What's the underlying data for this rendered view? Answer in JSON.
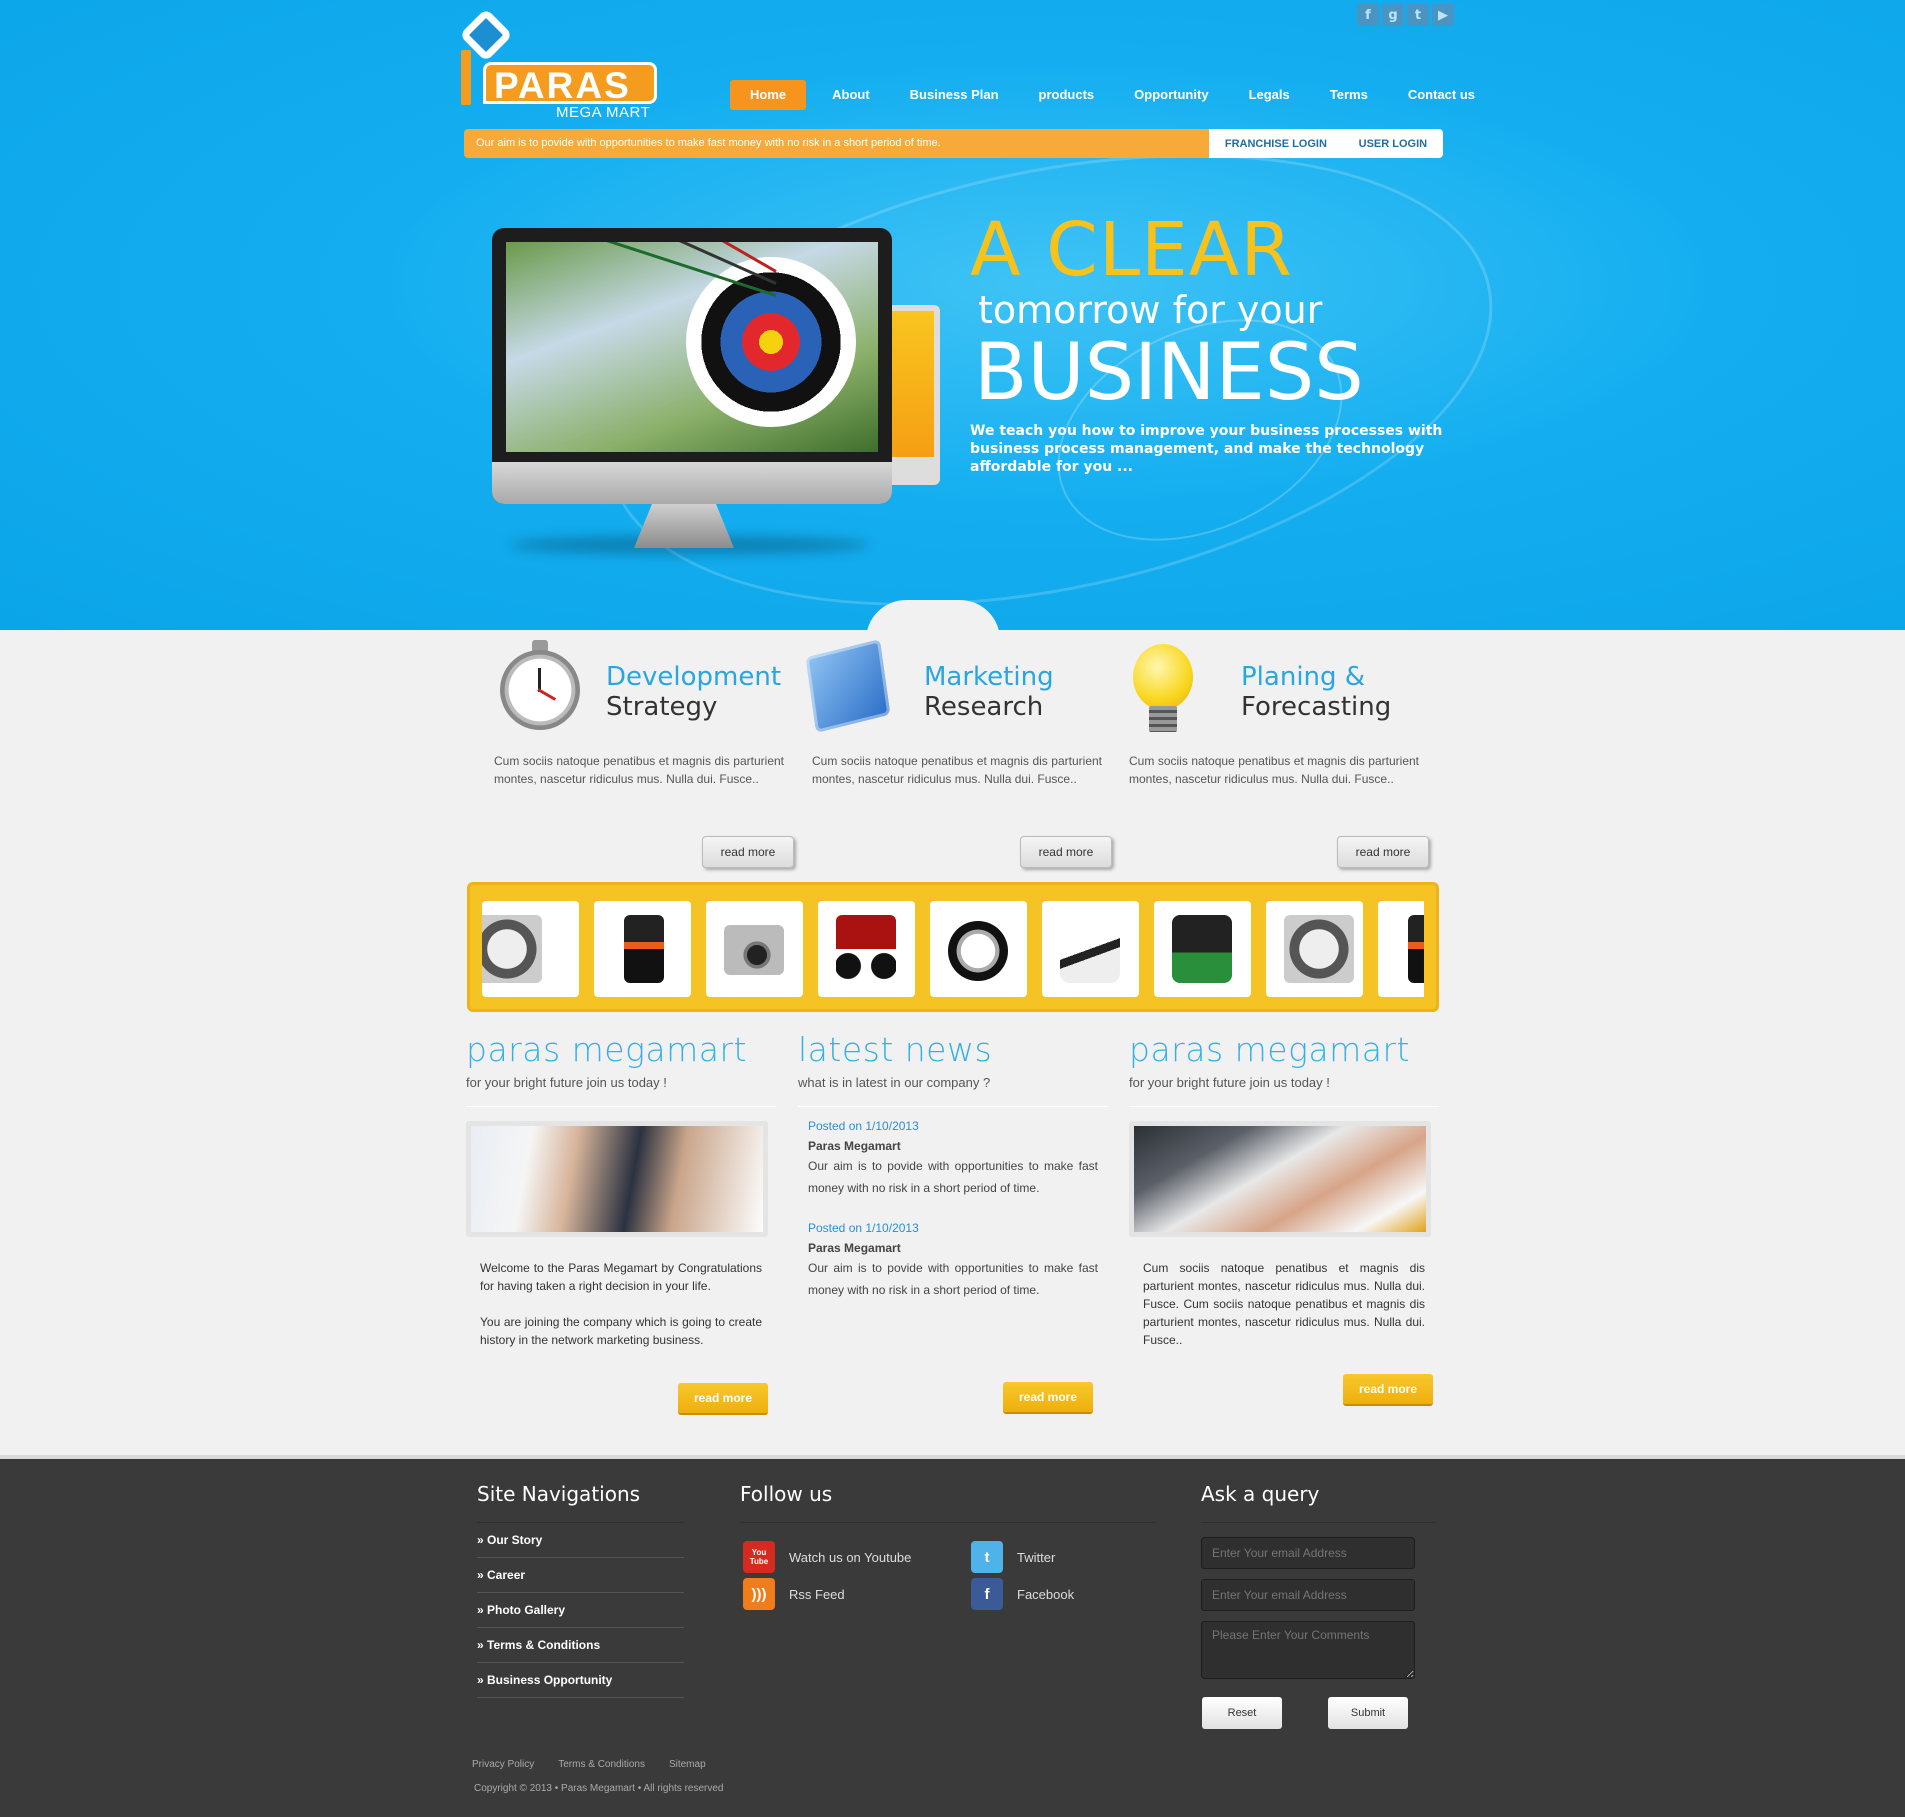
{
  "social_top": [
    {
      "icon": "facebook-icon",
      "glyph": "f"
    },
    {
      "icon": "google-icon",
      "glyph": "g"
    },
    {
      "icon": "tumblr-icon",
      "glyph": "t"
    },
    {
      "icon": "youtube-icon",
      "glyph": "▶"
    }
  ],
  "logo": {
    "name": "PARAS",
    "sub": "MEGA MART"
  },
  "nav": {
    "items": [
      "Home",
      "About",
      "Business Plan",
      "products",
      "Opportunity",
      "Legals",
      "Terms",
      "Contact us"
    ],
    "active": "Home"
  },
  "tagbar": {
    "message": "Our aim is to povide with opportunities to make fast money with no risk in a short period of time.",
    "franchise_login": "FRANCHISE LOGIN",
    "user_login": "USER LOGIN"
  },
  "hero": {
    "line1": "A CLEAR",
    "line2": "tomorrow for your",
    "line3": "BUSINESS",
    "paragraph": "We teach you how to improve your business processes with business process management, and make the technology affordable for you ..."
  },
  "features": [
    {
      "title1": "Development",
      "title2": "Strategy",
      "icon": "stopwatch-icon",
      "desc": "Cum sociis natoque penatibus et magnis dis parturient montes, nascetur ridiculus mus. Nulla dui. Fusce..",
      "button": "read more"
    },
    {
      "title1": "Marketing",
      "title2": "Research",
      "icon": "cube-icon",
      "desc": "Cum sociis natoque penatibus et magnis dis parturient montes, nascetur ridiculus mus. Nulla dui. Fusce..",
      "button": "read more"
    },
    {
      "title1": "Planing &",
      "title2": "Forecasting",
      "icon": "lightbulb-icon",
      "desc": "Cum sociis natoque penatibus et magnis dis parturient montes, nascetur ridiculus mus. Nulla dui. Fusce..",
      "button": "read more"
    }
  ],
  "products": [
    "roti-maker-icon",
    "mobile-phone-icon",
    "camera-icon",
    "motorbike-icon",
    "wristwatch-icon",
    "sneaker-icon",
    "energy-saver-icon",
    "roti-maker-icon",
    "mobile-phone-icon"
  ],
  "col_left": {
    "title": "paras megamart",
    "subtitle": "for your bright future join us today !",
    "p1": "Welcome to the Paras Megamart by Congratulations for having taken a right decision in your life.",
    "p2": "You are joining the company which is going to create history in the network marketing business.",
    "button": "read more"
  },
  "col_mid": {
    "title": "latest news",
    "subtitle": "what is in latest in our company ?",
    "news": [
      {
        "date": "Posted on 1/10/2013",
        "who": "Paras Megamart",
        "body": "Our aim is to povide with opportunities to make fast money with no risk in a short period of time."
      },
      {
        "date": "Posted on 1/10/2013",
        "who": "Paras Megamart",
        "body": "Our aim is to povide with opportunities to make fast money with no risk in a short period of time."
      }
    ],
    "button": "read more"
  },
  "col_right": {
    "title": "paras megamart",
    "subtitle": "for your bright future join us today !",
    "p1": "Cum sociis natoque penatibus et magnis dis parturient montes, nascetur ridiculus mus. Nulla dui. Fusce. Cum sociis natoque penatibus et magnis dis parturient montes, nascetur ridiculus mus. Nulla dui. Fusce..",
    "button": "read more"
  },
  "footer": {
    "nav_title": "Site Navigations",
    "nav_items": [
      "» Our Story",
      "» Career",
      "» Photo Gallery",
      "» Terms & Conditions",
      "» Business Opportunity"
    ],
    "follow_title": "Follow us",
    "follow": [
      {
        "label": "Watch us on Youtube",
        "icon": "youtube-icon",
        "glyph": "You\nTube",
        "color": "#d42a1f"
      },
      {
        "label": "Twitter",
        "icon": "twitter-icon",
        "glyph": "t",
        "color": "#4fb2e8"
      },
      {
        "label": "Rss Feed",
        "icon": "rss-icon",
        "glyph": "))",
        "color": "#f07d1a"
      },
      {
        "label": "Facebook",
        "icon": "facebook-icon",
        "glyph": "f",
        "color": "#3a5a98"
      }
    ],
    "query_title": "Ask a query",
    "email1_placeholder": "Enter Your email Address",
    "email2_placeholder": "Enter Your email Address",
    "comments_placeholder": "Please Enter Your Comments",
    "reset": "Reset",
    "submit": "Submit",
    "links": [
      "Privacy Policy",
      "Terms & Conditions",
      "Sitemap"
    ],
    "copyright": "Copyright © 2013   • Paras Megamart   • All rights reserved"
  }
}
